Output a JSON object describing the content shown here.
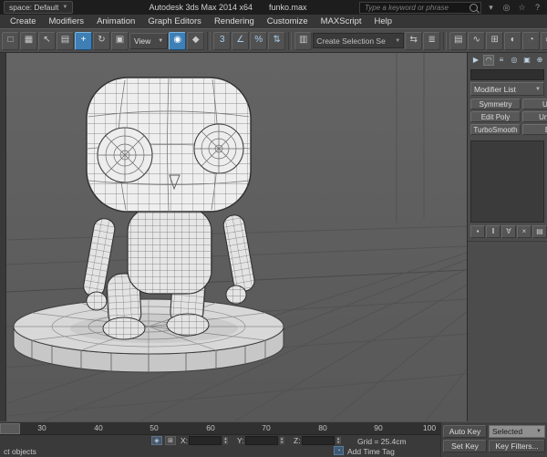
{
  "title_bar": {
    "workspace_label": "space: Default",
    "app_name": "Autodesk 3ds Max 2014 x64",
    "file_name": "funko.max",
    "search_placeholder": "Type a keyword or phrase",
    "icons": [
      {
        "name": "infocenter-dropdown-icon",
        "glyph": "▾"
      },
      {
        "name": "communication-center-icon",
        "glyph": "◎"
      },
      {
        "name": "favorites-icon",
        "glyph": "☆"
      },
      {
        "name": "help-icon",
        "glyph": "?"
      }
    ]
  },
  "menus": [
    "Create",
    "Modifiers",
    "Animation",
    "Graph Editors",
    "Rendering",
    "Customize",
    "MAXScript",
    "Help"
  ],
  "toolbar": {
    "view_label": "View",
    "selection_set_label": "Create Selection Se",
    "icons": [
      {
        "name": "selection-region-icon",
        "glyph": "□"
      },
      {
        "name": "window-crossing-icon",
        "glyph": "▦"
      },
      {
        "name": "select-object-icon",
        "glyph": "↖"
      },
      {
        "name": "select-by-name-icon",
        "glyph": "▤"
      },
      {
        "name": "select-and-move-icon",
        "glyph": "+"
      },
      {
        "name": "select-and-rotate-icon",
        "glyph": "↻"
      },
      {
        "name": "select-and-scale-icon",
        "glyph": "▣"
      },
      {
        "name": "use-pivot-point-icon",
        "glyph": "◉"
      },
      {
        "name": "select-and-manipulate-icon",
        "glyph": "◆"
      },
      {
        "name": "snaps-toggle-icon",
        "glyph": "3"
      },
      {
        "name": "angle-snap-icon",
        "glyph": "∠"
      },
      {
        "name": "percent-snap-icon",
        "glyph": "%"
      },
      {
        "name": "spinner-snap-icon",
        "glyph": "⇅"
      },
      {
        "name": "edit-named-selection-sets-icon",
        "glyph": "▥"
      },
      {
        "name": "mirror-icon",
        "glyph": "⇆"
      },
      {
        "name": "align-icon",
        "glyph": "≣"
      },
      {
        "name": "layer-manager-icon",
        "glyph": "▤"
      },
      {
        "name": "curve-editor-icon",
        "glyph": "∿"
      },
      {
        "name": "schematic-view-icon",
        "glyph": "⊞"
      },
      {
        "name": "material-editor-icon",
        "glyph": "◐"
      },
      {
        "name": "render-setup-icon",
        "glyph": "◔"
      },
      {
        "name": "rendered-frame-icon",
        "glyph": "▭"
      },
      {
        "name": "render-production-icon",
        "glyph": "◕"
      }
    ]
  },
  "command_panel": {
    "tabs": [
      {
        "name": "tab-create",
        "glyph": "▶"
      },
      {
        "name": "tab-modify",
        "glyph": "◠"
      },
      {
        "name": "tab-hierarchy",
        "glyph": "≡"
      },
      {
        "name": "tab-motion",
        "glyph": "◎"
      },
      {
        "name": "tab-display",
        "glyph": "▣"
      },
      {
        "name": "tab-utilities",
        "glyph": "⊕"
      }
    ],
    "modifier_list_label": "Modifier List",
    "modifier_buttons": [
      "Symmetry",
      "UV",
      "Edit Poly",
      "Unwr",
      "TurboSmooth",
      "E"
    ],
    "stack_tools": [
      {
        "name": "pin-stack-icon",
        "glyph": "▪"
      },
      {
        "name": "show-end-result-icon",
        "glyph": "‖"
      },
      {
        "name": "make-unique-icon",
        "glyph": "∀"
      },
      {
        "name": "remove-modifier-icon",
        "glyph": "×"
      },
      {
        "name": "configure-modifier-sets-icon",
        "glyph": "▤"
      }
    ]
  },
  "timeline": {
    "ticks": [
      "30",
      "40",
      "50",
      "60",
      "70",
      "80",
      "90",
      "100"
    ]
  },
  "status_bar": {
    "prompt": "ct objects",
    "coords": [
      {
        "label": "X:",
        "value": ""
      },
      {
        "label": "Y:",
        "value": ""
      },
      {
        "label": "Z:",
        "value": ""
      }
    ],
    "grid_label": "Grid = 25.4cm",
    "add_time_tag_label": "Add Time Tag",
    "auto_key_label": "Auto Key",
    "selected_label": "Selected",
    "set_key_label": "Set Key",
    "key_filters_label": "Key Filters..."
  },
  "colors": {
    "accent_blue": "#3e7fb5",
    "viewport_bg": "#5e5e5e"
  }
}
